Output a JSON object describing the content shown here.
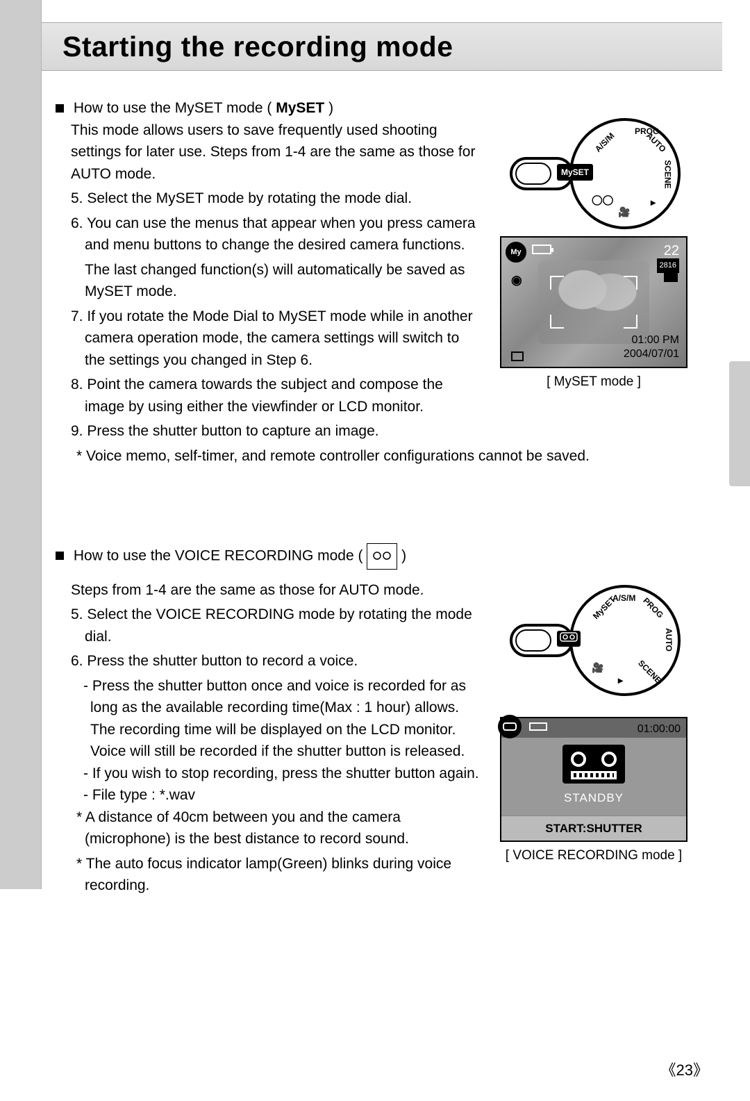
{
  "page_title": "Starting the recording mode",
  "page_number": "23",
  "section_myset": {
    "heading_prefix": "How to use the MySET mode ( ",
    "heading_mode": "MySET",
    "heading_suffix": " )",
    "intro": "This mode allows users to save frequently used shooting settings for later use. Steps from 1-4 are the same as those for AUTO mode.",
    "step5": "5. Select the MySET mode by rotating the mode dial.",
    "step6": "6. You can use the menus that appear when you press camera and menu buttons to change the desired camera functions.",
    "step6b": "The last changed function(s) will automatically be saved as MySET mode.",
    "step7": "7. If you rotate the Mode Dial to MySET mode while in another camera operation mode, the camera settings will switch to the settings you changed in Step 6.",
    "step8": "8. Point the camera towards the subject and compose the image by using either the viewfinder or LCD monitor.",
    "step9": "9. Press the shutter button to capture an image.",
    "note": "* Voice memo, self-timer, and remote controller configurations cannot be saved.",
    "dial_mode_label": "MySET",
    "dial_labels": {
      "prog": "PROG",
      "asm": "A/S/M",
      "auto": "AUTO",
      "scene": "SCENE"
    },
    "lcd": {
      "badge": "My",
      "shots": "22",
      "resolution": "2816",
      "time": "01:00 PM",
      "date": "2004/07/01",
      "caption": "[ MySET mode ]"
    }
  },
  "section_voice": {
    "heading_prefix": "How to use the VOICE RECORDING mode ( ",
    "heading_suffix": " )",
    "intro": "Steps from 1-4 are the same as those for AUTO mode.",
    "step5": "5. Select the VOICE RECORDING mode by rotating the mode dial.",
    "step6": "6. Press the shutter button to record a voice.",
    "sub1": "- Press the shutter button once and voice is recorded for as long as the available recording time(Max : 1 hour) allows. The recording time will be displayed on the LCD monitor. Voice will still be recorded if the shutter button is released.",
    "sub2": "- If you wish to stop recording, press the shutter button again.",
    "sub3": "- File type : *.wav",
    "note1": "* A distance of 40cm between you and the camera (microphone) is the best distance to record sound.",
    "note2": "* The auto focus indicator lamp(Green) blinks during voice recording.",
    "dial_labels": {
      "prog": "PROG",
      "asm": "A/S/M",
      "myset": "MySET",
      "auto": "AUTO",
      "scene": "SCENE"
    },
    "lcd": {
      "time": "01:00:00",
      "standby": "STANDBY",
      "start": "START:SHUTTER",
      "caption": "[ VOICE RECORDING mode ]"
    }
  }
}
